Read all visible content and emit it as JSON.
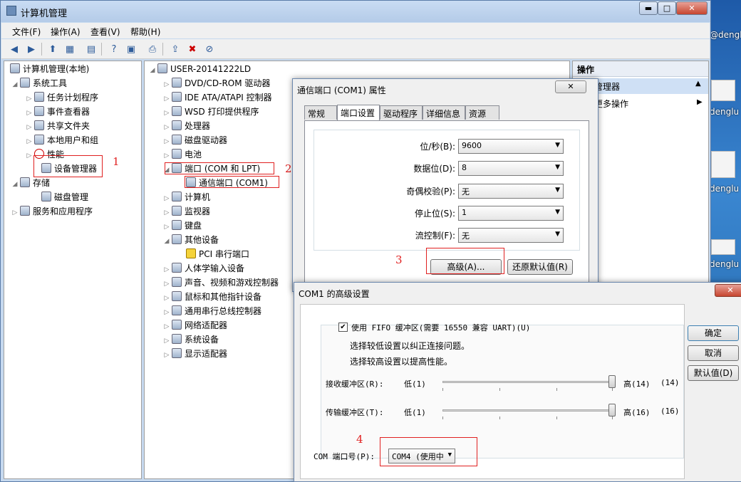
{
  "desktop": {
    "labels": [
      "@denglu",
      "denglu",
      "denglu",
      "denglu"
    ]
  },
  "window": {
    "title": "计算机管理",
    "min": "▬",
    "max": "□",
    "close": "✕"
  },
  "menu": [
    "文件(F)",
    "操作(A)",
    "查看(V)",
    "帮助(H)"
  ],
  "left_tree": {
    "root": "计算机管理(本地)",
    "system_tools": "系统工具",
    "task_scheduler": "任务计划程序",
    "event_viewer": "事件查看器",
    "shared_folders": "共享文件夹",
    "local_users": "本地用户和组",
    "performance": "性能",
    "device_manager": "设备管理器",
    "storage": "存储",
    "disk_management": "磁盘管理",
    "services_apps": "服务和应用程序"
  },
  "device_tree": {
    "computer": "USER-20141222LD",
    "items": [
      "DVD/CD-ROM 驱动器",
      "IDE ATA/ATAPI 控制器",
      "WSD 打印提供程序",
      "处理器",
      "磁盘驱动器",
      "电池"
    ],
    "ports": "端口 (COM 和 LPT)",
    "com1": "通信端口 (COM1)",
    "items2": [
      "计算机",
      "监视器",
      "键盘"
    ],
    "other": "其他设备",
    "pci": "PCI 串行端口",
    "items3": [
      "人体学输入设备",
      "声音、视频和游戏控制器",
      "鼠标和其他指针设备",
      "通用串行总线控制器",
      "网络适配器",
      "系统设备",
      "显示适配器"
    ]
  },
  "actions": {
    "header": "操作",
    "selected": "管理器",
    "more": "更多操作"
  },
  "props_dialog": {
    "title": "通信端口 (COM1) 属性",
    "close": "✕",
    "tabs": [
      "常规",
      "端口设置",
      "驱动程序",
      "详细信息",
      "资源"
    ],
    "fields": [
      {
        "label": "位/秒(B):",
        "value": "9600"
      },
      {
        "label": "数据位(D):",
        "value": "8"
      },
      {
        "label": "奇偶校验(P):",
        "value": "无"
      },
      {
        "label": "停止位(S):",
        "value": "1"
      },
      {
        "label": "流控制(F):",
        "value": "无"
      }
    ],
    "advanced_button": "高级(A)...",
    "restore_button": "还原默认值(R)"
  },
  "adv_dialog": {
    "title": "COM1 的高级设置",
    "close": "✕",
    "fifo_label": "使用 FIFO 缓冲区(需要 16550 兼容 UART)(U)",
    "fifo_checked": true,
    "hint1": "选择较低设置以纠正连接问题。",
    "hint2": "选择较高设置以提高性能。",
    "rx_label": "接收缓冲区(R):",
    "rx_low": "低(1)",
    "rx_high": "高(14)",
    "rx_value": "(14)",
    "rx_level": 1.0,
    "tx_label": "传输缓冲区(T):",
    "tx_low": "低(1)",
    "tx_high": "高(16)",
    "tx_value": "(16)",
    "tx_level": 1.0,
    "com_label": "COM 端口号(P):",
    "com_value": "COM4 (使用中",
    "ok": "确定",
    "cancel": "取消",
    "defaults": "默认值(D)"
  },
  "annotations": [
    "1",
    "2",
    "3",
    "4"
  ]
}
